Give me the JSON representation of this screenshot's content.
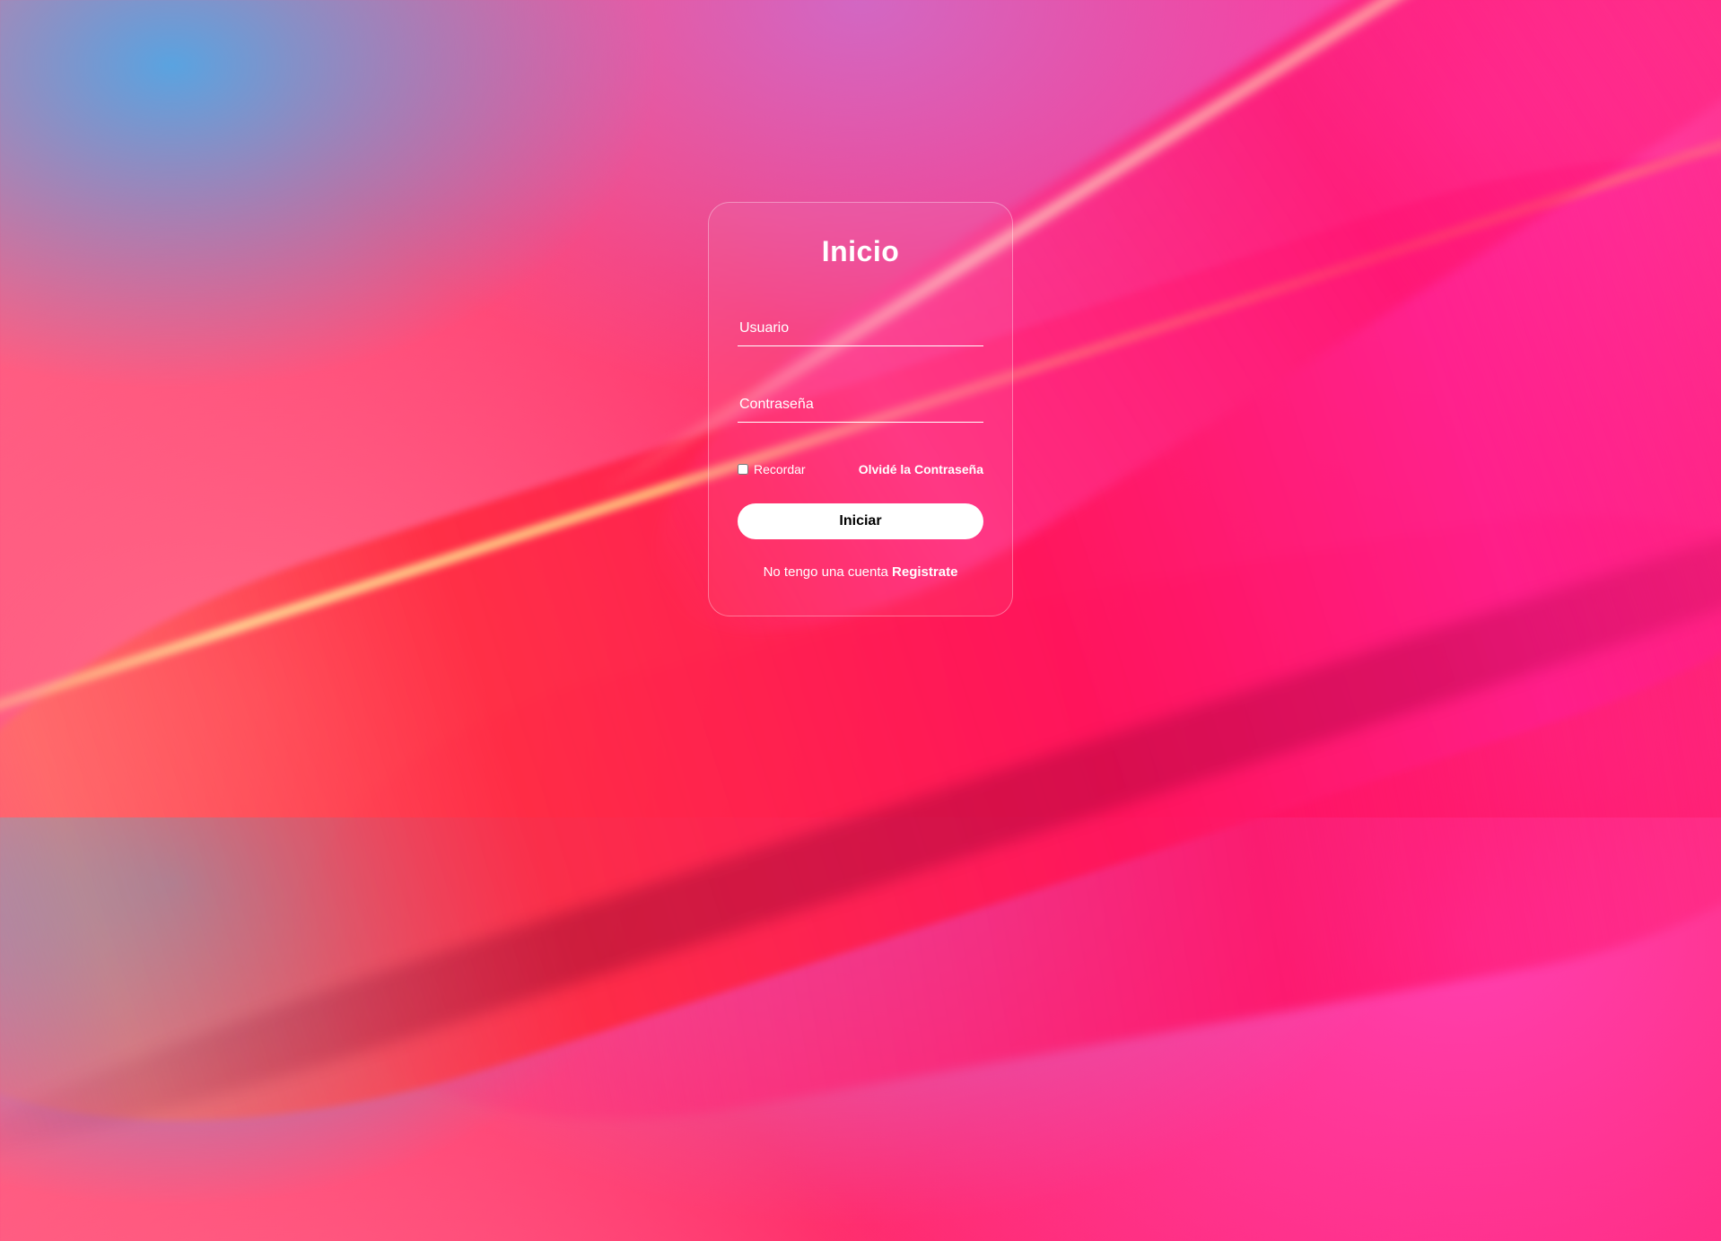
{
  "title": "Inicio",
  "fields": {
    "username_label": "Usuario",
    "password_label": "Contraseña"
  },
  "remember_label": "Recordar",
  "forgot_label": "Olvidé la Contraseña",
  "submit_label": "Iniciar",
  "register_prefix": "No tengo una cuenta ",
  "register_link": "Registrate"
}
